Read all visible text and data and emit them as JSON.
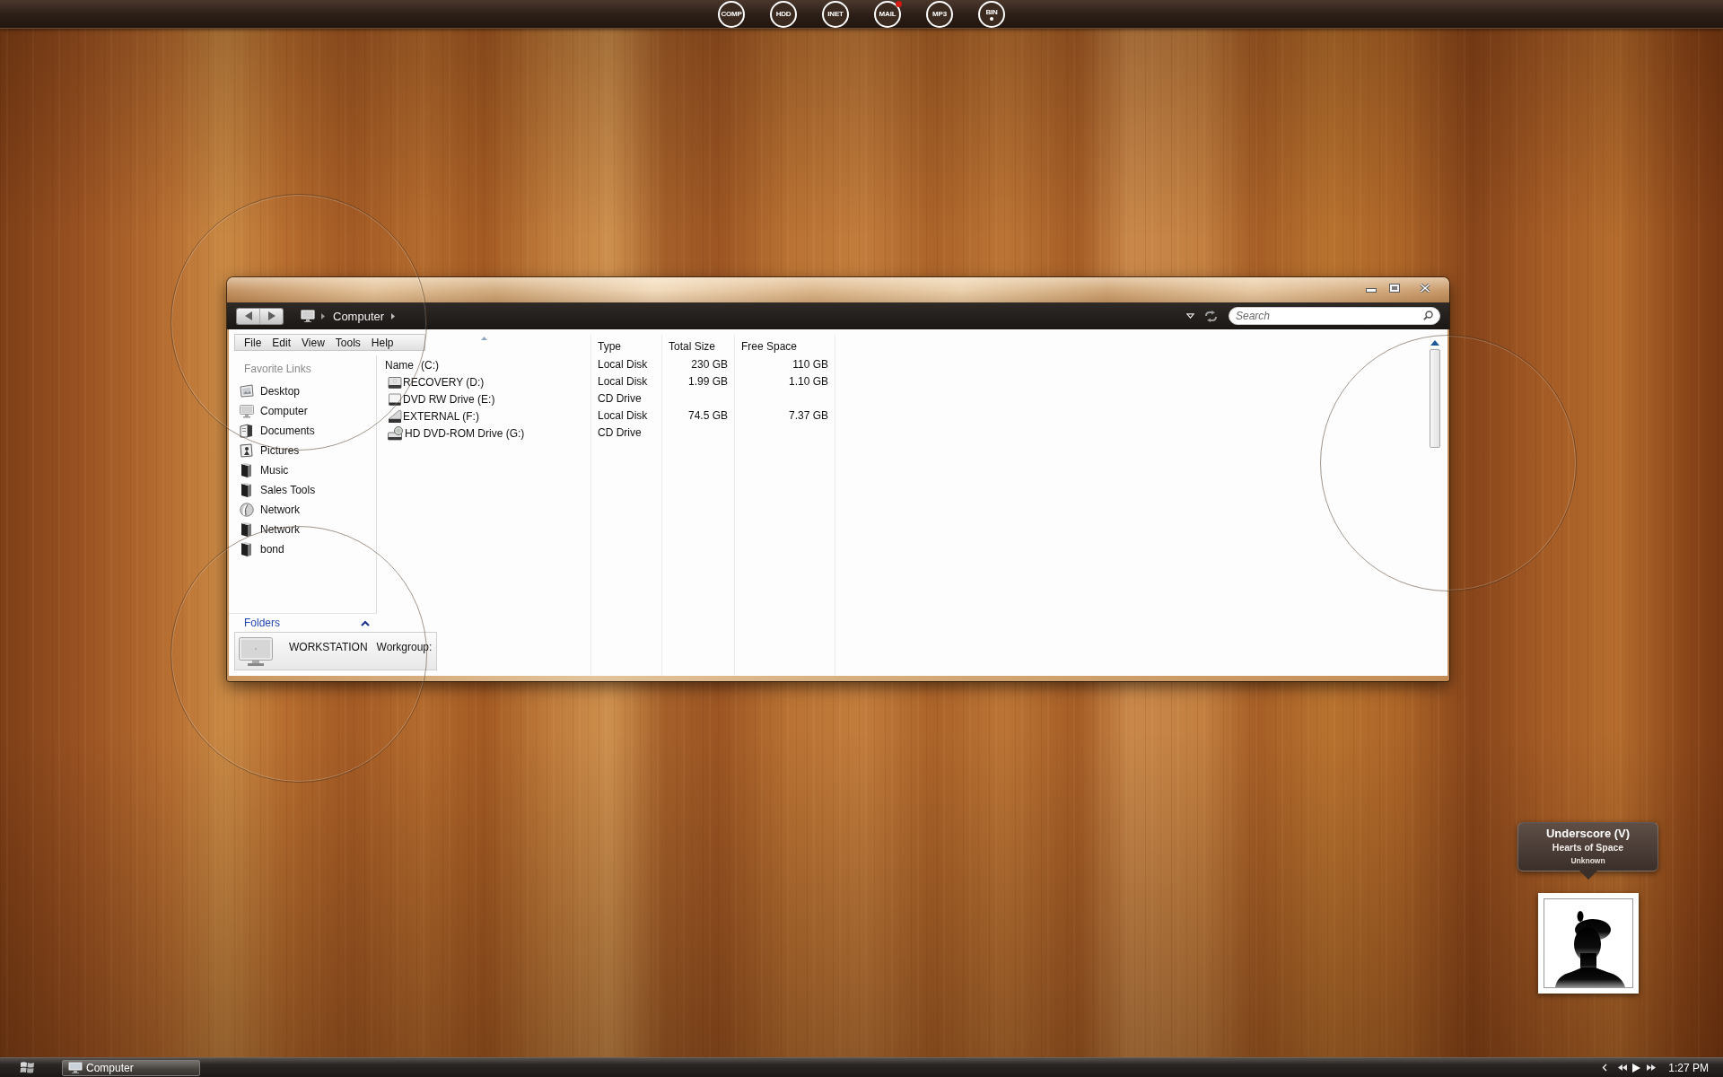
{
  "dock": {
    "shortcuts": [
      {
        "label": "COMP",
        "kind": "plain"
      },
      {
        "label": "HDD",
        "kind": "plain"
      },
      {
        "label": "INET",
        "kind": "plain"
      },
      {
        "label": "MAIL",
        "kind": "alert"
      },
      {
        "label": "MP3",
        "kind": "plain"
      },
      {
        "label": "BIN",
        "kind": "dot"
      }
    ]
  },
  "window": {
    "breadcrumb": "Computer",
    "search": {
      "placeholder": "Search"
    },
    "menu": [
      "File",
      "Edit",
      "View",
      "Tools",
      "Help"
    ],
    "favorite_links": {
      "heading": "Favorite Links",
      "items": [
        {
          "label": "Desktop",
          "kind": "desktop"
        },
        {
          "label": "Computer",
          "kind": "computer"
        },
        {
          "label": "Documents",
          "kind": "documents"
        },
        {
          "label": "Pictures",
          "kind": "pictures"
        },
        {
          "label": "Music",
          "kind": "folder"
        },
        {
          "label": "Sales Tools",
          "kind": "folder"
        },
        {
          "label": "Network",
          "kind": "network"
        },
        {
          "label": "Network",
          "kind": "folder"
        },
        {
          "label": "bond",
          "kind": "folder"
        }
      ]
    },
    "folders": {
      "label": "Folders",
      "expanded": true
    },
    "details": {
      "name": "WORKSTATION",
      "workgroup": "Workgroup:"
    },
    "table": {
      "columns": [
        {
          "label": "Name",
          "sorted": true
        },
        {
          "label": "Type",
          "sorted": false
        },
        {
          "label": "Total Size",
          "sorted": false
        },
        {
          "label": "Free Space",
          "sorted": false
        }
      ],
      "rows": [
        {
          "name": "(C:)",
          "kind": "none",
          "type": "Local Disk",
          "total": "230 GB",
          "free": "110 GB"
        },
        {
          "name": "RECOVERY (D:)",
          "kind": "disk",
          "type": "Local Disk",
          "total": "1.99 GB",
          "free": "1.10 GB"
        },
        {
          "name": "DVD RW Drive (E:)",
          "kind": "dvd",
          "type": "CD Drive"
        },
        {
          "name": "EXTERNAL (F:)",
          "kind": "external",
          "type": "Local Disk",
          "total": "74.5 GB",
          "free": "7.37 GB"
        },
        {
          "name": "HD DVD-ROM Drive (G:)",
          "kind": "hddvd",
          "type": "CD Drive"
        }
      ]
    }
  },
  "now_playing": {
    "title": "Underscore (V)",
    "album": "Hearts of Space",
    "artist": "Unknown"
  },
  "taskbar": {
    "tasks": [
      {
        "label": "Computer",
        "selected": true
      }
    ],
    "clock": "1:27 PM"
  }
}
